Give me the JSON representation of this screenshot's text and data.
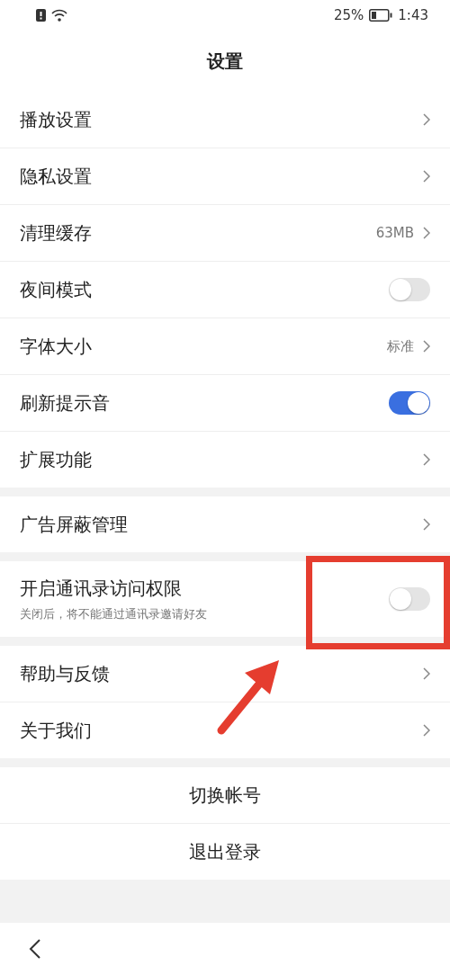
{
  "status_bar": {
    "battery_text": "25%",
    "time": "1:43"
  },
  "title": "设置",
  "groups": [
    [
      {
        "kind": "link",
        "label": "播放设置"
      },
      {
        "kind": "link",
        "label": "隐私设置"
      },
      {
        "kind": "link",
        "label": "清理缓存",
        "value": "63MB"
      },
      {
        "kind": "toggle",
        "label": "夜间模式",
        "on": false
      },
      {
        "kind": "link",
        "label": "字体大小",
        "value": "标准"
      },
      {
        "kind": "toggle",
        "label": "刷新提示音",
        "on": true
      },
      {
        "kind": "link",
        "label": "扩展功能"
      }
    ],
    [
      {
        "kind": "link",
        "label": "广告屏蔽管理"
      }
    ],
    [
      {
        "kind": "toggle",
        "label": "开启通讯录访问权限",
        "subtitle": "关闭后，将不能通过通讯录邀请好友",
        "on": false
      }
    ],
    [
      {
        "kind": "link",
        "label": "帮助与反馈"
      },
      {
        "kind": "link",
        "label": "关于我们"
      }
    ]
  ],
  "actions": [
    "切换帐号",
    "退出登录"
  ]
}
